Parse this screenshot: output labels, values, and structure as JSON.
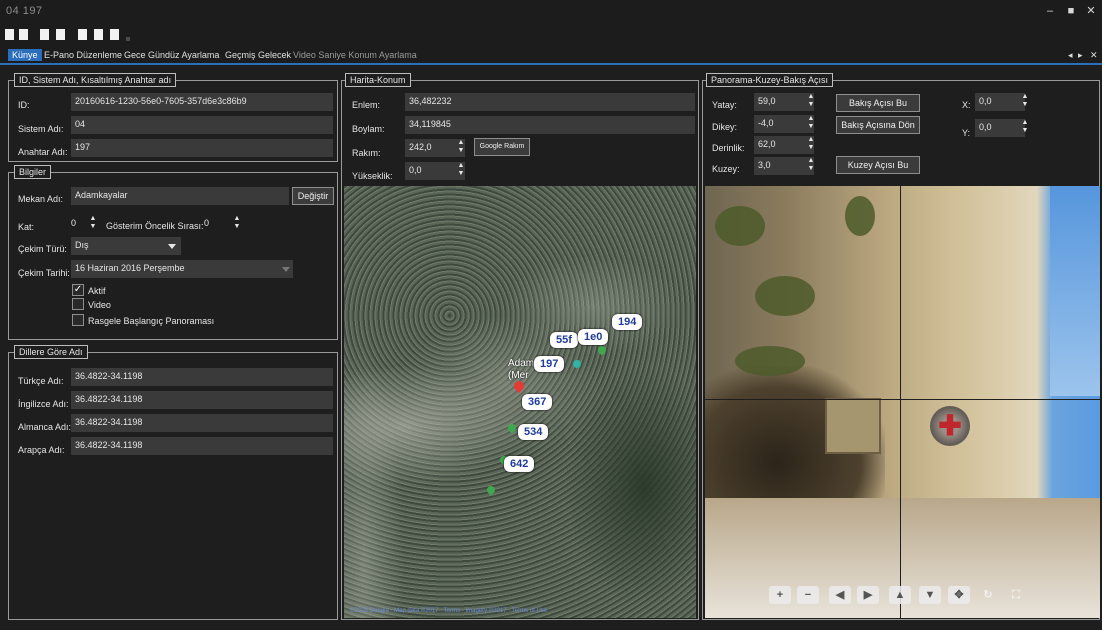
{
  "window": {
    "title": "04 197",
    "minimize": "‒",
    "maximize": "■",
    "close": "✕"
  },
  "tabs": [
    {
      "label": "Künye",
      "active": true
    },
    {
      "label": "E-Pano Düzenleme"
    },
    {
      "label": "Gece Gündüz Ayarlama"
    },
    {
      "label": "Geçmiş Gelecek"
    },
    {
      "label": "Video Saniye Konum Ayarlama",
      "dim": true
    }
  ],
  "tab_nav": {
    "prev": "◂",
    "next": "▸",
    "close": "✕"
  },
  "ids_panel": {
    "title": "ID, Sistem Adı, Kısaltılmış Anahtar adı",
    "id_label": "ID:",
    "id_value": "20160616-1230-56e0-7605-357d6e3c86b9",
    "system_label": "Sistem Adı:",
    "system_value": "04",
    "key_label": "Anahtar Adı:",
    "key_value": "197"
  },
  "info_panel": {
    "title": "Bilgiler",
    "place_label": "Mekan Adı:",
    "place_value": "Adamkayalar",
    "change_button": "Değiştir",
    "floor_label": "Kat:",
    "floor_value": "0",
    "priority_label": "Gösterim Öncelik Sırası:",
    "priority_value": "0",
    "shot_type_label": "Çekim Türü:",
    "shot_type_value": "Dış",
    "shot_date_label": "Çekim Tarihi:",
    "shot_date_value": "16 Haziran 2016 Perşembe",
    "active_label": "Aktif",
    "active_checked": true,
    "video_label": "Video",
    "video_checked": false,
    "random_label": "Rasgele Başlangıç Panoraması",
    "random_checked": false
  },
  "names_panel": {
    "title": "Dillere Göre Adı",
    "rows": [
      {
        "label": "Türkçe Adı:",
        "value": "36.4822-34.1198"
      },
      {
        "label": "İngilizce Adı:",
        "value": "36.4822-34.1198"
      },
      {
        "label": "Almanca Adı:",
        "value": "36.4822-34.1198"
      },
      {
        "label": "Arapça Adı:",
        "value": "36.4822-34.1198"
      }
    ]
  },
  "map_panel": {
    "title": "Harita-Konum",
    "lat_label": "Enlem:",
    "lat_value": "36,482232",
    "lon_label": "Boylam:",
    "lon_value": "34,119845",
    "alt_label": "Rakım:",
    "alt_value": "242,0",
    "google_alt_button": "Google Rakım",
    "height_label": "Yükseklik:",
    "height_value": "0,0",
    "place_caption_1": "Adam",
    "place_caption_2": "(Mer",
    "markers": [
      "194",
      "55f",
      "1e0",
      "197",
      "367",
      "534",
      "642"
    ],
    "credit": "©2016 Google · Map data ©2017 · Terms · Imagery ©2017 · Terms of Use"
  },
  "pano_panel": {
    "title": "Panorama-Kuzey-Bakış Açısı",
    "yatay_label": "Yatay:",
    "yatay_value": "59,0",
    "dikey_label": "Dikey:",
    "dikey_value": "-4,0",
    "derinlik_label": "Derinlik:",
    "derinlik_value": "62,0",
    "kuzey_label": "Kuzey:",
    "kuzey_value": "3,0",
    "view_button": "Bakış Açısı Bu",
    "return_button": "Bakış Açısına Dön",
    "north_button": "Kuzey Açısı Bu",
    "x_label": "X:",
    "x_value": "0,0",
    "y_label": "Y:",
    "y_value": "0,0",
    "controls": [
      "+",
      "−",
      "◀",
      "▶",
      "▲",
      "▼",
      "✥",
      "↻",
      "⛶"
    ]
  },
  "colors": {
    "accent": "#2a6ebc",
    "field": "#3a3a3a",
    "panel_bg": "#1e1e1e",
    "marker_text": "#1f3c9a"
  }
}
